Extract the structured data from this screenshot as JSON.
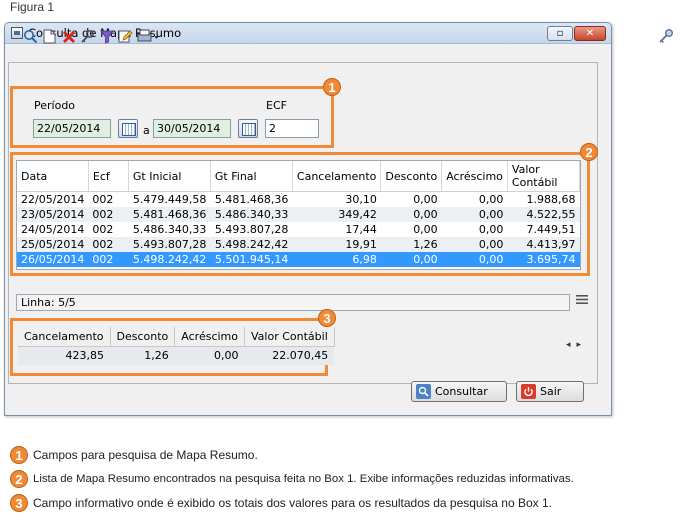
{
  "figure_caption": "Figura 1",
  "window": {
    "title": "Consulta de Mapa Resumo",
    "controls": {
      "restore": "▫",
      "close": "✕"
    }
  },
  "toolbar": {
    "icons": [
      "magnifier-icon",
      "new-document-icon",
      "delete-x-icon",
      "key-search-icon",
      "filter-funnel-icon",
      "edit-pencil-icon",
      "print-dropdown-icon"
    ]
  },
  "filters": {
    "periodo_label": "Período",
    "date_from": "22/05/2014",
    "separator": "a",
    "date_to": "30/05/2014",
    "ecf_label": "ECF",
    "ecf_value": "2"
  },
  "grid": {
    "columns": [
      "Data",
      "Ecf",
      "Gt Inicial",
      "Gt Final",
      "Cancelamento",
      "Desconto",
      "Acréscimo",
      "Valor Contábil"
    ],
    "rows": [
      [
        "22/05/2014",
        "002",
        "5.479.449,58",
        "5.481.468,36",
        "30,10",
        "0,00",
        "0,00",
        "1.988,68"
      ],
      [
        "23/05/2014",
        "002",
        "5.481.468,36",
        "5.486.340,33",
        "349,42",
        "0,00",
        "0,00",
        "4.522,55"
      ],
      [
        "24/05/2014",
        "002",
        "5.486.340,33",
        "5.493.807,28",
        "17,44",
        "0,00",
        "0,00",
        "7.449,51"
      ],
      [
        "25/05/2014",
        "002",
        "5.493.807,28",
        "5.498.242,42",
        "19,91",
        "1,26",
        "0,00",
        "4.413,97"
      ],
      [
        "26/05/2014",
        "002",
        "5.498.242,42",
        "5.501.945,14",
        "6,98",
        "0,00",
        "0,00",
        "3.695,74"
      ]
    ],
    "selected_row": 4
  },
  "status": {
    "linha": "Linha: 5/5"
  },
  "totals": {
    "columns": [
      "Cancelamento",
      "Desconto",
      "Acréscimo",
      "Valor Contábil"
    ],
    "values": [
      "423,85",
      "1,26",
      "0,00",
      "22.070,45"
    ]
  },
  "buttons": {
    "consultar": "Consultar",
    "sair": "Sair"
  },
  "badges": [
    "1",
    "2",
    "3"
  ],
  "legend": [
    "Campos para pesquisa de Mapa Resumo.",
    "Lista de Mapa Resumo encontrados na pesquisa feita no Box 1. Exibe informações reduzidas informativas.",
    "Campo informativo onde é exibido os totais dos valores para os resultados da pesquisa no Box 1."
  ],
  "colors": {
    "highlight_orange": "#f08a36",
    "selection_blue": "#3399ff",
    "date_field_green": "#dff0e0"
  }
}
